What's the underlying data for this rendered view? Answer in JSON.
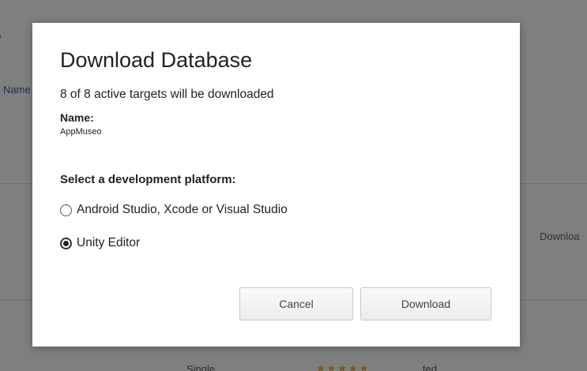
{
  "background": {
    "top_left_fragment": "o",
    "name_fragment": "Name",
    "download_fragment": "Downloa",
    "bottom_fragment_left": "Single",
    "bottom_fragment_right": "ted"
  },
  "modal": {
    "title": "Download Database",
    "subtitle": "8 of 8 active targets will be downloaded",
    "name_label": "Name:",
    "name_value": "AppMuseo",
    "platform_heading": "Select a development platform:",
    "options": [
      {
        "label": "Android Studio, Xcode or Visual Studio",
        "selected": false
      },
      {
        "label": "Unity Editor",
        "selected": true
      }
    ],
    "cancel_label": "Cancel",
    "download_label": "Download"
  },
  "colors": {
    "overlay": "#808080",
    "link": "#2a6aa8"
  }
}
